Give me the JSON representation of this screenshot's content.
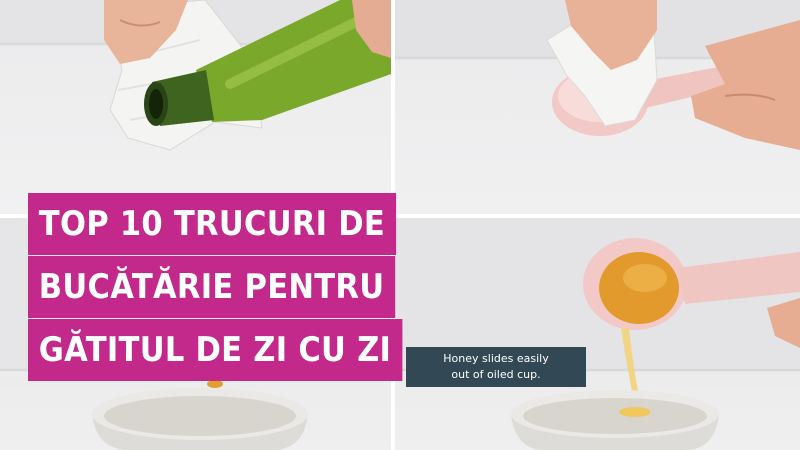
{
  "title": {
    "line1": "TOP 10 TRUCURI DE",
    "line2": "BUCĂTĂRIE PENTRU",
    "line3": "GĂTITUL DE ZI CU ZI"
  },
  "caption": {
    "line1": "Honey slides easily",
    "line2": "out of oiled cup."
  },
  "colors": {
    "title_background": "#c3298a",
    "caption_background": "#324854",
    "honey": "#e0a030",
    "olive_oil_bottle": "#7aa82a",
    "measuring_cup": "#f2c9c6"
  }
}
